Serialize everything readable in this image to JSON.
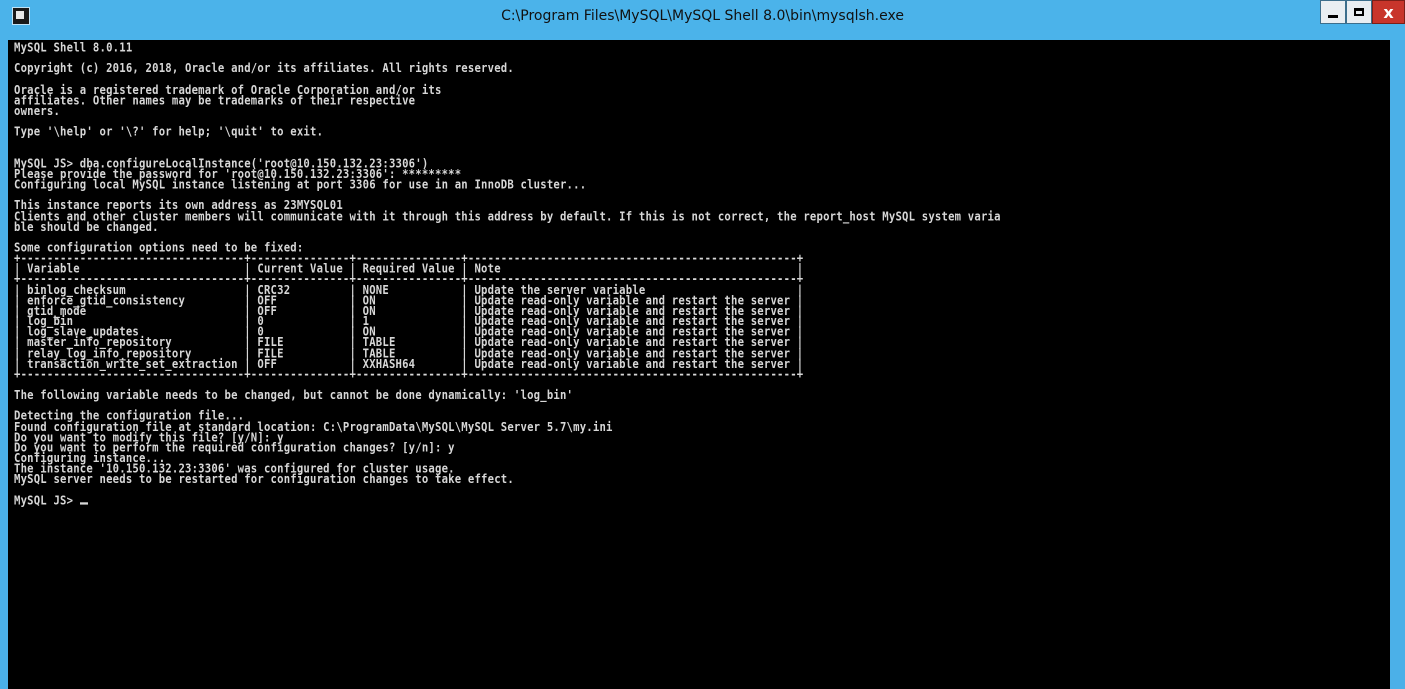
{
  "window": {
    "title": "C:\\Program Files\\MySQL\\MySQL Shell 8.0\\bin\\mysqlsh.exe",
    "controls": {
      "minimize": "_",
      "maximize": "□",
      "close": "x"
    }
  },
  "console": {
    "lines": [
      "MySQL Shell 8.0.11",
      "",
      "Copyright (c) 2016, 2018, Oracle and/or its affiliates. All rights reserved.",
      "",
      "Oracle is a registered trademark of Oracle Corporation and/or its",
      "affiliates. Other names may be trademarks of their respective",
      "owners.",
      "",
      "Type '\\help' or '\\?' for help; '\\quit' to exit.",
      "",
      "",
      "MySQL JS> dba.configureLocalInstance('root@10.150.132.23:3306')",
      "Please provide the password for 'root@10.150.132.23:3306': *********",
      "Configuring local MySQL instance listening at port 3306 for use in an InnoDB cluster...",
      "",
      "This instance reports its own address as 23MYSQL01",
      "Clients and other cluster members will communicate with it through this address by default. If this is not correct, the report_host MySQL system varia",
      "ble should be changed.",
      "",
      "Some configuration options need to be fixed:",
      "+----------------------------------+---------------+----------------+--------------------------------------------------+",
      "| Variable                         | Current Value | Required Value | Note                                             |",
      "+----------------------------------+---------------+----------------+--------------------------------------------------+",
      "| binlog_checksum                  | CRC32         | NONE           | Update the server variable                       |",
      "| enforce_gtid_consistency         | OFF           | ON             | Update read-only variable and restart the server |",
      "| gtid_mode                        | OFF           | ON             | Update read-only variable and restart the server |",
      "| log_bin                          | 0             | 1              | Update read-only variable and restart the server |",
      "| log_slave_updates                | 0             | ON             | Update read-only variable and restart the server |",
      "| master_info_repository           | FILE          | TABLE          | Update read-only variable and restart the server |",
      "| relay_log_info_repository        | FILE          | TABLE          | Update read-only variable and restart the server |",
      "| transaction_write_set_extraction | OFF           | XXHASH64       | Update read-only variable and restart the server |",
      "+----------------------------------+---------------+----------------+--------------------------------------------------+",
      "",
      "The following variable needs to be changed, but cannot be done dynamically: 'log_bin'",
      "",
      "Detecting the configuration file...",
      "Found configuration file at standard location: C:\\ProgramData\\MySQL\\MySQL Server 5.7\\my.ini",
      "Do you want to modify this file? [y/N]: y",
      "Do you want to perform the required configuration changes? [y/n]: y",
      "Configuring instance...",
      "The instance '10.150.132.23:3306' was configured for cluster usage.",
      "MySQL server needs to be restarted for configuration changes to take effect.",
      ""
    ],
    "prompt": "MySQL JS> "
  }
}
